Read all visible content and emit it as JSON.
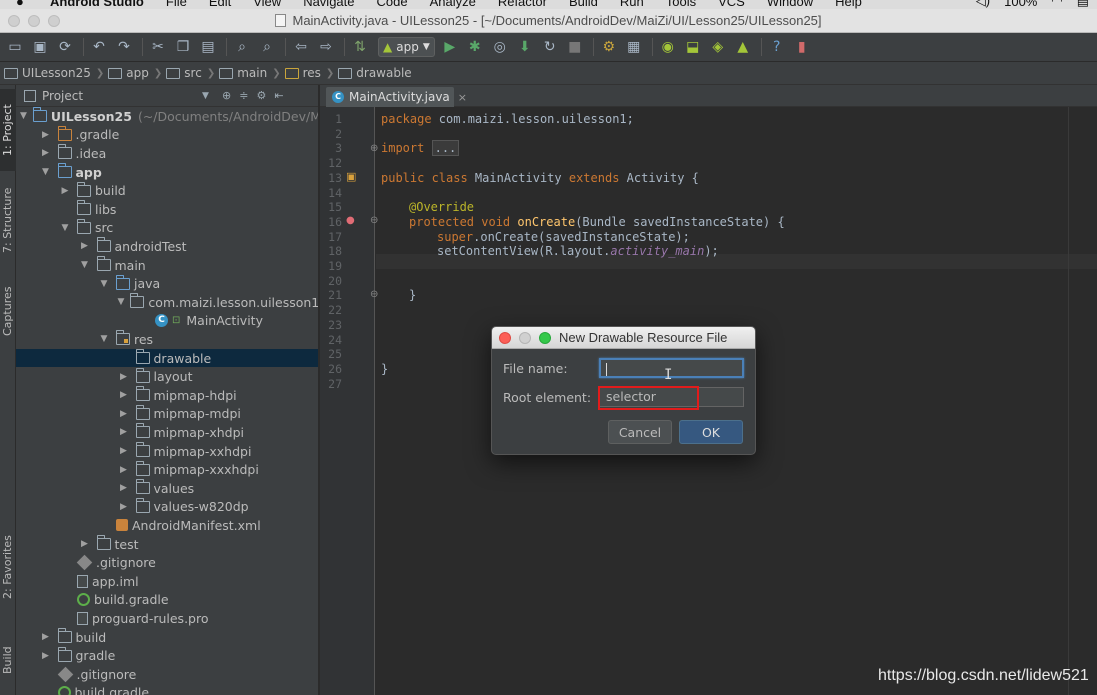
{
  "menubar": {
    "app_name": "Android Studio",
    "items": [
      "File",
      "Edit",
      "View",
      "Navigate",
      "Code",
      "Analyze",
      "Refactor",
      "Build",
      "Run",
      "Tools",
      "VCS",
      "Window",
      "Help"
    ],
    "battery": "100%"
  },
  "window": {
    "title": "MainActivity.java - UILesson25 - [~/Documents/AndroidDev/MaiZi/UI/Lesson25/UILesson25]"
  },
  "toolbar": {
    "run_config": "app"
  },
  "breadcrumbs": [
    "UILesson25",
    "app",
    "src",
    "main",
    "res",
    "drawable"
  ],
  "left_strip": {
    "tabs": [
      "1: Project",
      "7: Structure",
      "Captures",
      "2: Favorites",
      "Build Variants"
    ]
  },
  "project_panel": {
    "title": "Project",
    "tree": [
      {
        "label": "UILesson25",
        "path_hint": "(~/Documents/AndroidDev/MaiZi",
        "depth": 0,
        "arrow": "down",
        "icon": "project"
      },
      {
        "label": ".gradle",
        "depth": 1,
        "arrow": "right",
        "icon": "folder-orange"
      },
      {
        "label": ".idea",
        "depth": 1,
        "arrow": "right",
        "icon": "folder"
      },
      {
        "label": "app",
        "depth": 1,
        "arrow": "down",
        "icon": "module"
      },
      {
        "label": "build",
        "depth": 2,
        "arrow": "right",
        "icon": "folder"
      },
      {
        "label": "libs",
        "depth": 2,
        "arrow": "none",
        "icon": "folder"
      },
      {
        "label": "src",
        "depth": 2,
        "arrow": "down",
        "icon": "folder"
      },
      {
        "label": "androidTest",
        "depth": 3,
        "arrow": "right",
        "icon": "folder"
      },
      {
        "label": "main",
        "depth": 3,
        "arrow": "down",
        "icon": "folder"
      },
      {
        "label": "java",
        "depth": 4,
        "arrow": "down",
        "icon": "folder-blue"
      },
      {
        "label": "com.maizi.lesson.uilesson1",
        "depth": 5,
        "arrow": "down",
        "icon": "package"
      },
      {
        "label": "MainActivity",
        "depth": 6,
        "arrow": "none",
        "icon": "class"
      },
      {
        "label": "res",
        "depth": 4,
        "arrow": "down",
        "icon": "folder-res"
      },
      {
        "label": "drawable",
        "depth": 5,
        "arrow": "none",
        "icon": "folder",
        "selected": true
      },
      {
        "label": "layout",
        "depth": 5,
        "arrow": "right",
        "icon": "folder"
      },
      {
        "label": "mipmap-hdpi",
        "depth": 5,
        "arrow": "right",
        "icon": "folder"
      },
      {
        "label": "mipmap-mdpi",
        "depth": 5,
        "arrow": "right",
        "icon": "folder"
      },
      {
        "label": "mipmap-xhdpi",
        "depth": 5,
        "arrow": "right",
        "icon": "folder"
      },
      {
        "label": "mipmap-xxhdpi",
        "depth": 5,
        "arrow": "right",
        "icon": "folder"
      },
      {
        "label": "mipmap-xxxhdpi",
        "depth": 5,
        "arrow": "right",
        "icon": "folder"
      },
      {
        "label": "values",
        "depth": 5,
        "arrow": "right",
        "icon": "folder"
      },
      {
        "label": "values-w820dp",
        "depth": 5,
        "arrow": "right",
        "icon": "folder"
      },
      {
        "label": "AndroidManifest.xml",
        "depth": 4,
        "arrow": "none",
        "icon": "xml"
      },
      {
        "label": "test",
        "depth": 3,
        "arrow": "right",
        "icon": "folder"
      },
      {
        "label": ".gitignore",
        "depth": 2,
        "arrow": "none",
        "icon": "git"
      },
      {
        "label": "app.iml",
        "depth": 2,
        "arrow": "none",
        "icon": "file"
      },
      {
        "label": "build.gradle",
        "depth": 2,
        "arrow": "none",
        "icon": "gradle"
      },
      {
        "label": "proguard-rules.pro",
        "depth": 2,
        "arrow": "none",
        "icon": "file"
      },
      {
        "label": "build",
        "depth": 1,
        "arrow": "right",
        "icon": "folder"
      },
      {
        "label": "gradle",
        "depth": 1,
        "arrow": "right",
        "icon": "folder"
      },
      {
        "label": ".gitignore",
        "depth": 1,
        "arrow": "none",
        "icon": "git"
      },
      {
        "label": "build.gradle",
        "depth": 1,
        "arrow": "none",
        "icon": "gradle"
      }
    ]
  },
  "editor": {
    "tab_label": "MainActivity.java",
    "line_numbers": [
      "1",
      "2",
      "3",
      "12",
      "13",
      "14",
      "15",
      "16",
      "17",
      "18",
      "19",
      "20",
      "21",
      "22",
      "23",
      "24",
      "25",
      "26",
      "27"
    ],
    "code": {
      "l1_kw": "package",
      "l1_rest": " com.maizi.lesson.uilesson1;",
      "l3_kw": "import",
      "l3_fold": "...",
      "l13_kw1": "public class",
      "l13_name": " MainActivity ",
      "l13_kw2": "extends",
      "l13_rest": " Activity {",
      "l15_ann": "@Override",
      "l16_kw": "protected void",
      "l16_fn": " onCreate",
      "l16_rest": "(Bundle savedInstanceState) {",
      "l17_kw": "super",
      "l17_rest": ".onCreate(savedInstanceState);",
      "l18_a": "setContentView(R.layout.",
      "l18_it": "activity_main",
      "l18_b": ");",
      "l21": "}",
      "l26": "}"
    }
  },
  "dialog": {
    "title": "New Drawable Resource File",
    "file_name_label": "File name:",
    "file_name_value": "",
    "root_element_label": "Root element:",
    "root_element_value": "selector",
    "cancel_label": "Cancel",
    "ok_label": "OK"
  },
  "watermark": "https://blog.csdn.net/lidew521",
  "colors": {
    "accent_blue": "#365880",
    "highlight_red": "#e21b1b",
    "selection": "#0d293e"
  }
}
